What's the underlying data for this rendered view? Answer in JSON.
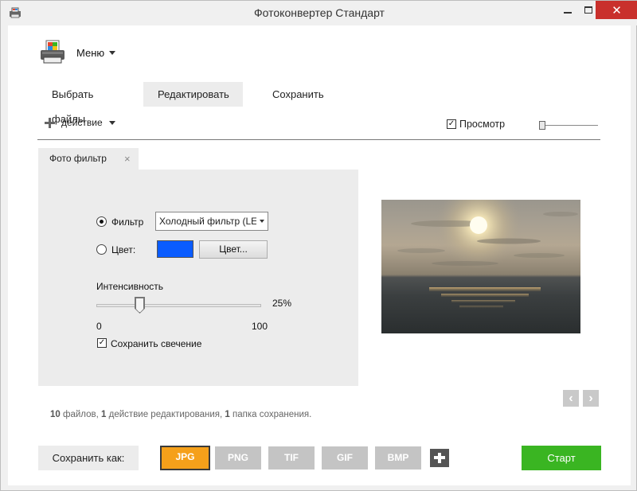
{
  "window": {
    "title": "Фотоконвертер Стандарт",
    "icons": {
      "app": "printer-app-icon",
      "minimize": "minimize-icon",
      "maximize": "maximize-icon",
      "close": "close-icon"
    },
    "close_glyph": "✕"
  },
  "header": {
    "logo_icon": "photo-printer-logo-icon",
    "menu_label": "Меню"
  },
  "tabs": [
    {
      "label": "Выбрать файлы",
      "active": false
    },
    {
      "label": "Редактировать",
      "active": true
    },
    {
      "label": "Сохранить",
      "active": false
    }
  ],
  "toolbar": {
    "add_action_label": "действие",
    "preview_label": "Просмотр",
    "preview_checked": true,
    "preview_check_glyph": "✓"
  },
  "panel": {
    "tab_label": "Фото фильтр",
    "tab_close_glyph": "×",
    "filter_radio_label": "Фильтр",
    "filter_selected": true,
    "filter_value": "Холодный фильтр (LE",
    "color_radio_label": "Цвет:",
    "color_swatch": "#0a5cff",
    "color_button_label": "Цвет...",
    "intensity_label": "Интенсивность",
    "intensity_value": "25%",
    "intensity_fraction": 0.25,
    "intensity_min": "0",
    "intensity_max": "100",
    "keep_glow_label": "Сохранить свечение",
    "keep_glow_checked": true,
    "check_glyph": "✓"
  },
  "preview": {
    "image": "sunset-over-sea-photo"
  },
  "navigation": {
    "prev_glyph": "‹",
    "next_glyph": "›"
  },
  "summary": {
    "files_count": "10",
    "files_text": "файлов,",
    "actions_count": "1",
    "actions_text": "действие редактирования,",
    "folders_count": "1",
    "folders_text": "папка сохранения."
  },
  "footer": {
    "save_as_label": "Сохранить как:",
    "formats": [
      {
        "label": "JPG",
        "active": true
      },
      {
        "label": "PNG",
        "active": false
      },
      {
        "label": "TIF",
        "active": false
      },
      {
        "label": "GIF",
        "active": false
      },
      {
        "label": "BMP",
        "active": false
      }
    ],
    "add_format_icon": "plus-icon",
    "start_label": "Старт"
  },
  "colors": {
    "accent_format": "#f5a01a",
    "start_button": "#3ab522",
    "close_button": "#c9302c",
    "panel_bg": "#ececec"
  }
}
